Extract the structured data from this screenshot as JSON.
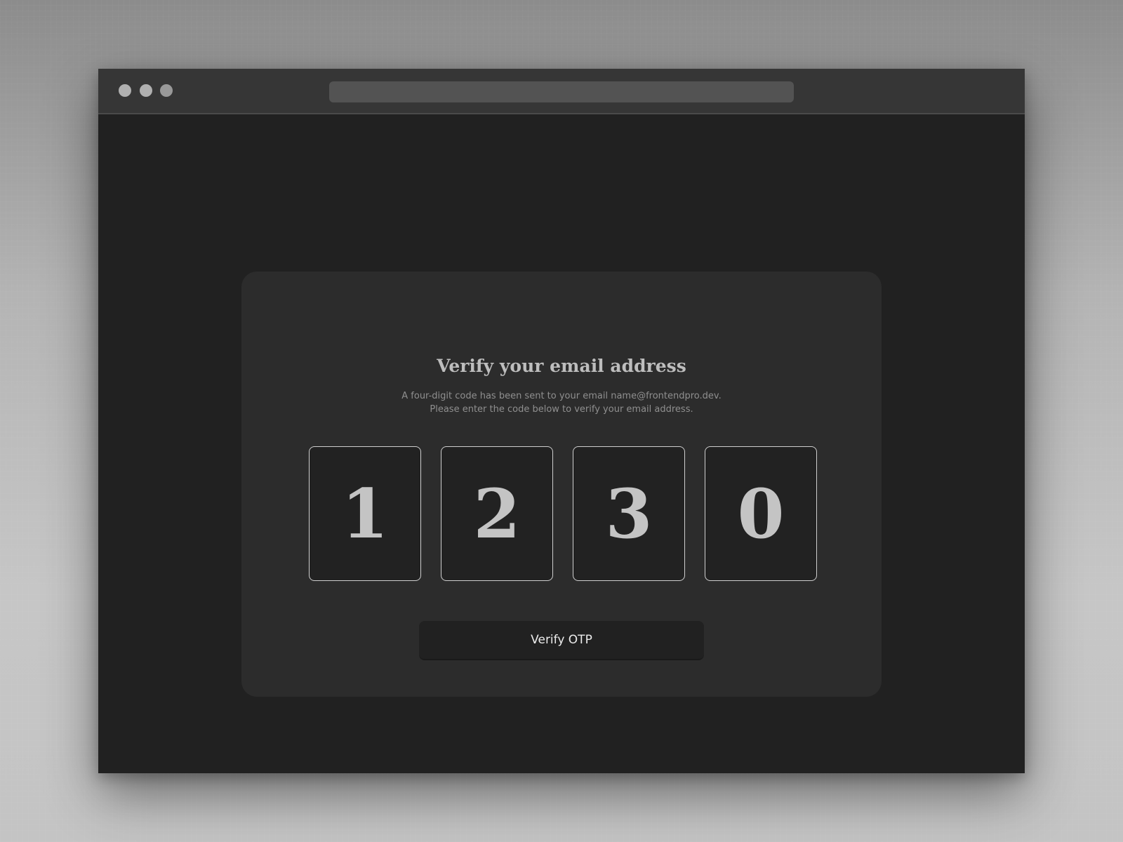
{
  "card": {
    "title": "Verify your email address",
    "description_line1": "A four-digit code has been sent to your email name@frontendpro.dev.",
    "description_line2": "Please enter the code below to verify your email address."
  },
  "otp": {
    "digits": [
      "1",
      "2",
      "3",
      "0"
    ]
  },
  "actions": {
    "verify_label": "Verify OTP"
  },
  "colors": {
    "background": "#212121",
    "card": "#2c2c2c",
    "title_bar": "#363636",
    "text_primary": "#bdbdbd",
    "text_muted": "#8f8f8f",
    "digit_border": "#cfcfcf"
  }
}
